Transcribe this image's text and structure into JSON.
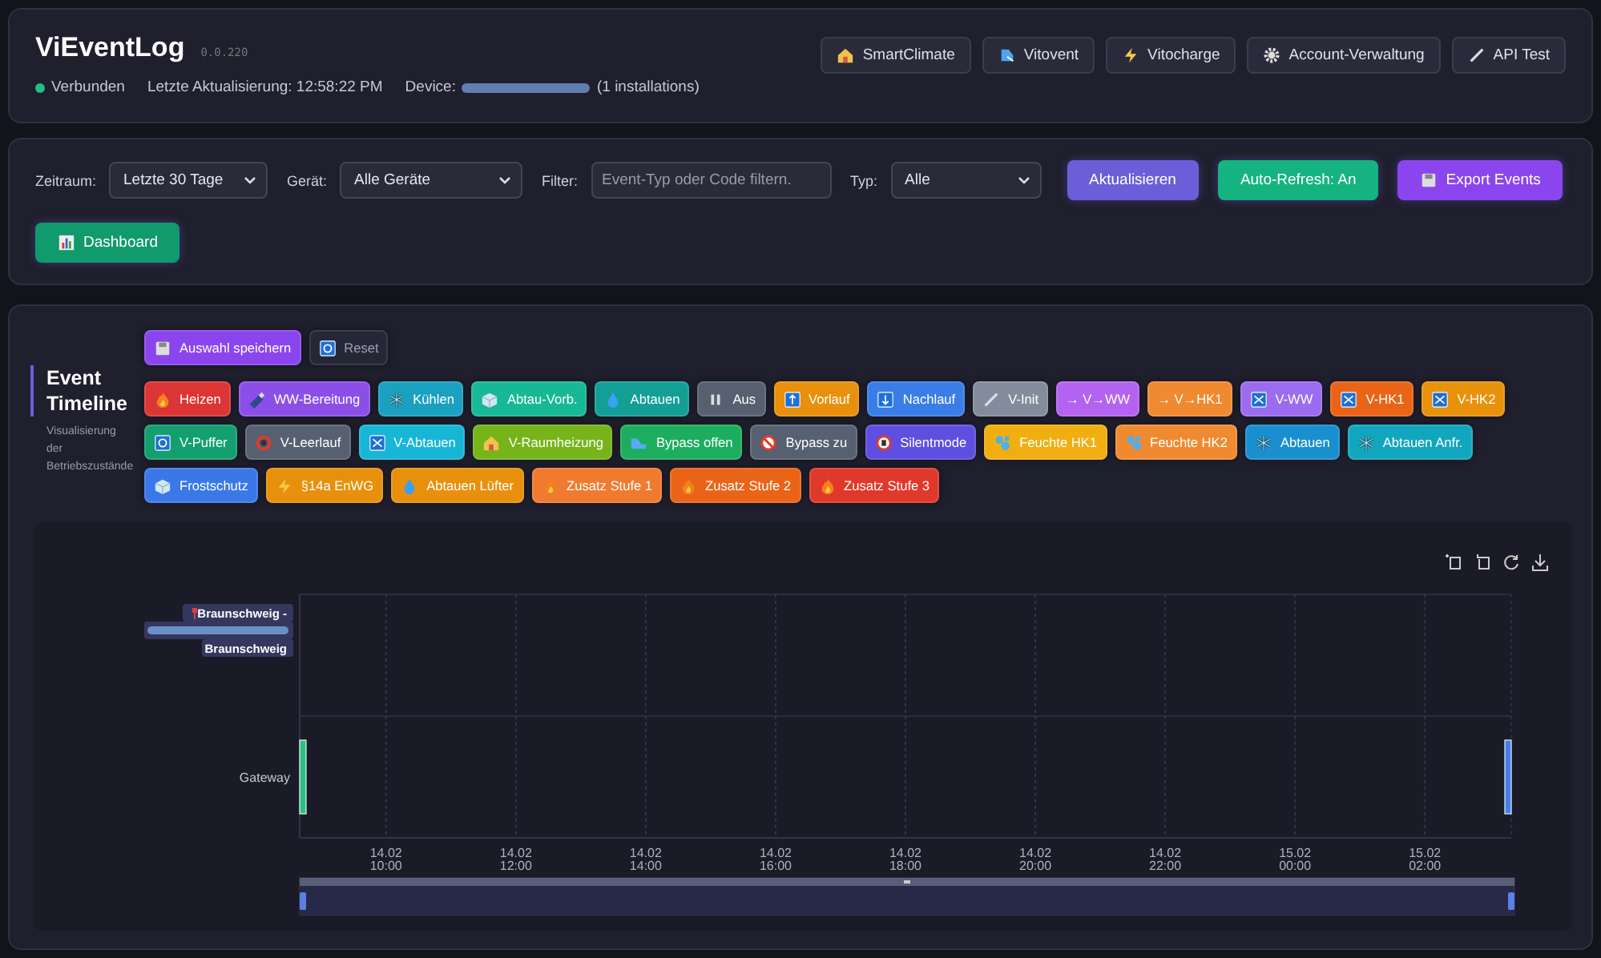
{
  "header": {
    "title": "ViEventLog",
    "version": "0.0.220",
    "status": "Verbunden",
    "connected": true,
    "last_update": "Letzte Aktualisierung: 12:58:22 PM",
    "device_label": "Device:",
    "device_suffix": "(1 installations)",
    "nav_buttons": [
      "SmartClimate",
      "Vitovent",
      "Vitocharge",
      "Account-Verwaltung",
      "API Test"
    ]
  },
  "filters": {
    "fields": [
      {
        "kind": "select",
        "label": "Zeitraum:",
        "value": "Letzte 30 Tage"
      },
      {
        "kind": "select",
        "label": "Gerät:",
        "value": "Alle Geräte"
      },
      {
        "kind": "input",
        "label": "Filter:",
        "placeholder": "Event-Typ oder Code filtern."
      },
      {
        "kind": "select",
        "label": "Typ:",
        "value": "Alle"
      }
    ],
    "buttons": [
      {
        "label": "Aktualisieren",
        "color": "#6a5fd8"
      },
      {
        "label": "Auto-Refresh: An",
        "color": "#15b37f"
      },
      {
        "label": "Export Events",
        "color": "#8b45ee"
      },
      {
        "label": "Dashboard",
        "color": "#119a6c"
      }
    ]
  },
  "timeline": {
    "title": "Event Timeline",
    "subtitle": "Visualisierung der Betriebszustände",
    "actions": [
      {
        "label": "Auswahl speichern",
        "color": "#8b45ee"
      },
      {
        "label": "Reset",
        "color": "#262636"
      }
    ],
    "event_rows": [
      [
        {
          "label": "Heizen",
          "color": "#dc3535"
        },
        {
          "label": "WW-Bereitung",
          "color": "#8b4fe8"
        },
        {
          "label": "Kühlen",
          "color": "#1aa0c0"
        },
        {
          "label": "Abtau-Vorb.",
          "color": "#17b896"
        },
        {
          "label": "Abtauen",
          "color": "#139e96"
        },
        {
          "label": "Aus",
          "color": "#566070"
        },
        {
          "label": "Vorlauf",
          "color": "#e8900c"
        },
        {
          "label": "Nachlauf",
          "color": "#3b7de8"
        },
        {
          "label": "V-Init",
          "color": "#838c9c"
        },
        {
          "label": "→ V→WW",
          "color": "#b463f0"
        },
        {
          "label": "→ V→HK1",
          "color": "#f08a30"
        },
        {
          "label": "V-WW",
          "color": "#9b6cf0"
        },
        {
          "label": "V-HK1",
          "color": "#ea6418"
        },
        {
          "label": "V-HK2",
          "color": "#e8920c"
        }
      ],
      [
        {
          "label": "V-Puffer",
          "color": "#139f70"
        },
        {
          "label": "V-Leerlauf",
          "color": "#566070"
        },
        {
          "label": "V-Abtauen",
          "color": "#18b6d6"
        },
        {
          "label": "V-Raumheizung",
          "color": "#76b41a"
        },
        {
          "label": "Bypass offen",
          "color": "#1cae5e"
        },
        {
          "label": "Bypass zu",
          "color": "#566070"
        },
        {
          "label": "Silentmode",
          "color": "#5f4fe0"
        },
        {
          "label": "Feuchte HK1",
          "color": "#f0ae10"
        },
        {
          "label": "Feuchte HK2",
          "color": "#f08a30"
        },
        {
          "label": "Abtauen",
          "color": "#1a8fd0"
        },
        {
          "label": "Abtauen Anfr.",
          "color": "#11a6be"
        }
      ],
      [
        {
          "label": "Frostschutz",
          "color": "#3a78e8"
        },
        {
          "label": "§14a EnWG",
          "color": "#e8900c"
        },
        {
          "label": "Abtauen Lüfter",
          "color": "#e8900c"
        },
        {
          "label": "Zusatz Stufe 1",
          "color": "#f07a30"
        },
        {
          "label": "Zusatz Stufe 2",
          "color": "#ea6418"
        },
        {
          "label": "Zusatz Stufe 3",
          "color": "#e0382a"
        }
      ]
    ],
    "time_labels": [
      "14.02\n10:00",
      "14.02\n12:00",
      "14.02\n14:00",
      "14.02\n16:00",
      "14.02\n18:00",
      "14.02\n20:00",
      "14.02\n22:00",
      "15.02\n00:00",
      "15.02\n02:00"
    ],
    "rows": [
      {
        "kind": "location",
        "lines": [
          "Braunschweig -",
          "Braunschweig"
        ],
        "events": []
      },
      {
        "kind": "device",
        "label": "Gateway",
        "events": [
          {
            "kind": "start",
            "color": "#2fbf86"
          },
          {
            "kind": "end",
            "color": "#4a7cf0"
          }
        ]
      }
    ]
  }
}
